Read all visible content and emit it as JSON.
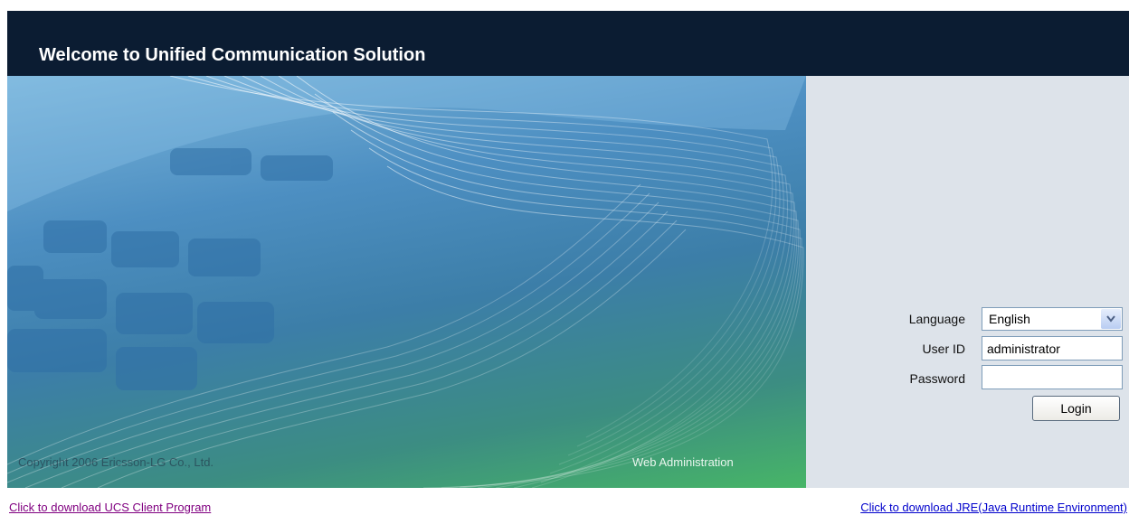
{
  "header": {
    "title": "Welcome to Unified Communication Solution"
  },
  "hero": {
    "copyright": "Copyright 2006 Ericsson-LG Co., Ltd.",
    "tagline": "Web Administration"
  },
  "login": {
    "language_label": "Language",
    "language_value": "English",
    "userid_label": "User ID",
    "userid_value": "administrator",
    "password_label": "Password",
    "password_value": "",
    "login_button": "Login"
  },
  "links": {
    "ucs_client": "Click to download UCS Client Program",
    "jre": "Click to download JRE(Java Runtime Environment)"
  },
  "colors": {
    "header_bg": "#0b1c32",
    "panel_bg": "#dde3ea",
    "visited_link": "#800080",
    "link": "#0000cc"
  }
}
